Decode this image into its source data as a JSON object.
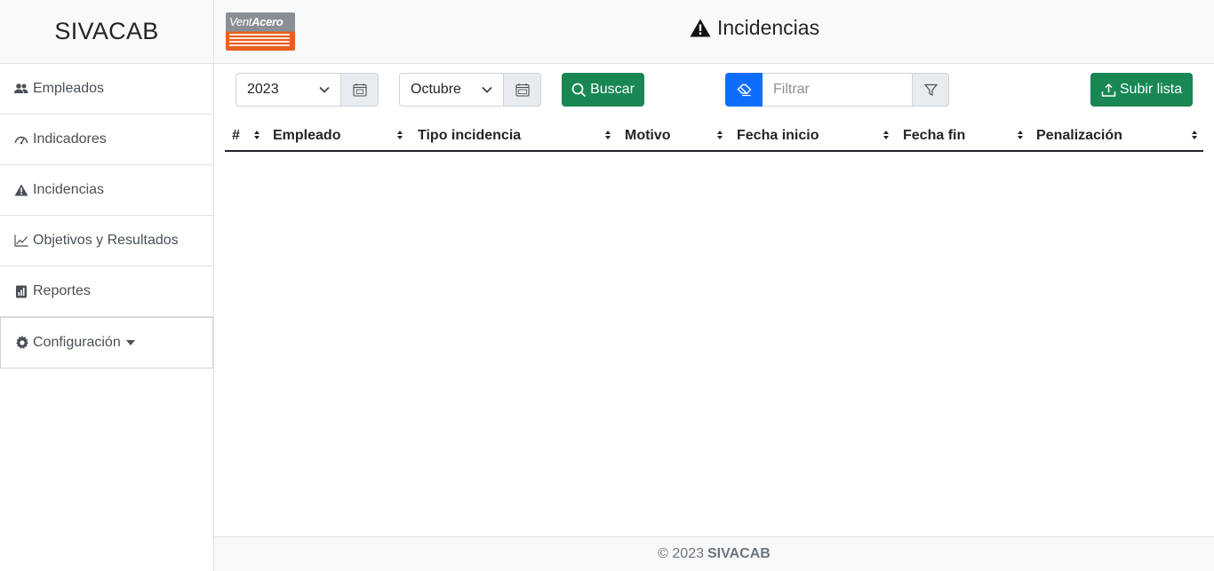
{
  "brand": "SIVACAB",
  "logo": {
    "text_a": "Vent",
    "text_b": "Acero",
    "mark": "VA"
  },
  "sidebar": {
    "items": [
      {
        "label": "Empleados",
        "icon": "people-icon"
      },
      {
        "label": "Indicadores",
        "icon": "speedometer-icon"
      },
      {
        "label": "Incidencias",
        "icon": "warning-icon"
      },
      {
        "label": "Objetivos y Resultados",
        "icon": "graph-up-icon"
      },
      {
        "label": "Reportes",
        "icon": "bar-chart-icon"
      },
      {
        "label": "Configuración",
        "icon": "gear-icon"
      }
    ]
  },
  "header": {
    "title": "Incidencias",
    "title_icon": "warning-icon"
  },
  "toolbar": {
    "year": "2023",
    "month": "Octubre",
    "search_label": "Buscar",
    "filter_placeholder": "Filtrar",
    "upload_label": "Subir lista"
  },
  "table": {
    "columns": [
      "#",
      "Empleado",
      "Tipo incidencia",
      "Motivo",
      "Fecha inicio",
      "Fecha fin",
      "Penalización"
    ],
    "rows": []
  },
  "footer": {
    "copyright": "© 2023",
    "brand": "SIVACAB"
  },
  "colors": {
    "primary_green": "#198754",
    "primary_blue": "#0d6efd",
    "logo_orange": "#e8601c",
    "logo_gray": "#8a8f95"
  }
}
